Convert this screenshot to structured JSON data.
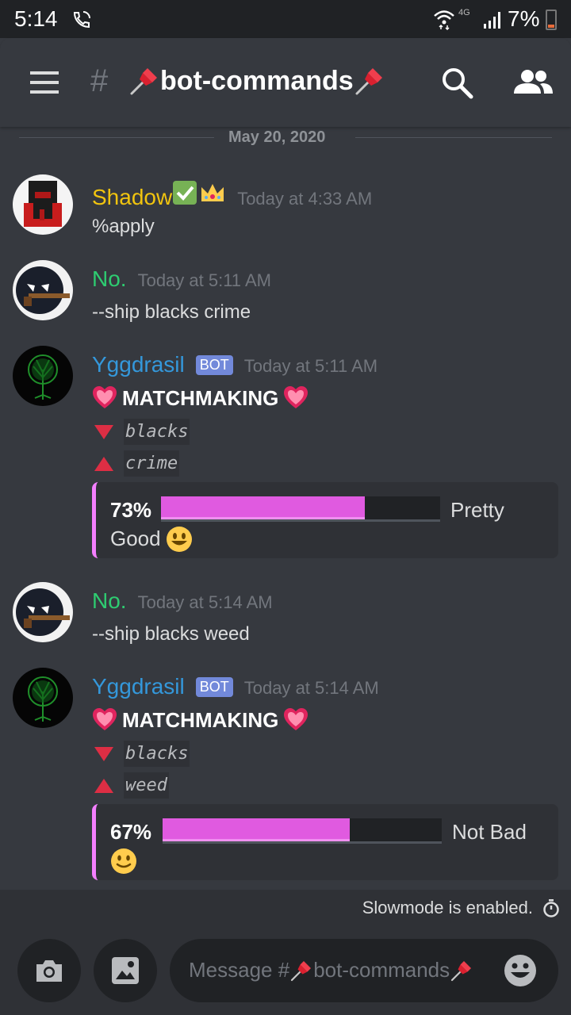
{
  "status_bar": {
    "time": "5:14",
    "network": "4G",
    "battery": "7%"
  },
  "header": {
    "hash": "#",
    "channel_name": "bot-commands"
  },
  "date_divider": "May 20, 2020",
  "messages": [
    {
      "username": "Shadow",
      "username_color": "#f1c40f",
      "timestamp": "Today at 4:33 AM",
      "text": "%apply"
    },
    {
      "username": "No.",
      "username_color": "#2ecc71",
      "timestamp": "Today at 5:11 AM",
      "text": "--ship blacks crime"
    },
    {
      "username": "Yggdrasil",
      "username_color": "#3498db",
      "bot_tag": "BOT",
      "timestamp": "Today at 5:11 AM",
      "title": "MATCHMAKING",
      "down_word": "blacks",
      "up_word": "crime",
      "embed": {
        "percent_label": "73%",
        "percent": 73,
        "label_line1": "Pretty",
        "label_line2": "Good"
      }
    },
    {
      "username": "No.",
      "username_color": "#2ecc71",
      "timestamp": "Today at 5:14 AM",
      "text": "--ship blacks weed"
    },
    {
      "username": "Yggdrasil",
      "username_color": "#3498db",
      "bot_tag": "BOT",
      "timestamp": "Today at 5:14 AM",
      "title": "MATCHMAKING",
      "down_word": "blacks",
      "up_word": "weed",
      "embed": {
        "percent_label": "67%",
        "percent": 67,
        "label_line1": "Not Bad"
      }
    }
  ],
  "slowmode": "Slowmode is enabled.",
  "composer": {
    "placeholder_prefix": "Message #",
    "placeholder_channel": "bot-commands"
  },
  "icons": [
    "menu-icon",
    "pushpin-icon",
    "search-icon",
    "members-icon",
    "camera-icon",
    "image-icon",
    "emoji-icon",
    "timer-icon",
    "heart-icon",
    "check-icon",
    "crown-icon",
    "smiley-icon"
  ]
}
